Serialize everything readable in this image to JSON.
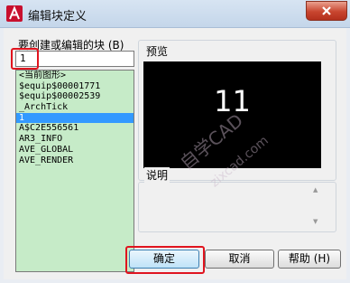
{
  "window": {
    "title": "编辑块定义"
  },
  "name_field": {
    "label": "要创建或编辑的块 (B)",
    "value": "1"
  },
  "block_list": {
    "items": [
      "<当前图形>",
      "$equip$00001771",
      "$equip$00002539",
      "_ArchTick",
      "1",
      "A$C2E556561",
      "AR3_INFO",
      "AVE_GLOBAL",
      "AVE_RENDER"
    ],
    "selected_index": 4
  },
  "preview": {
    "label": "预览",
    "text": "11"
  },
  "description": {
    "label": "说明"
  },
  "buttons": {
    "ok": "确定",
    "cancel": "取消",
    "help": "帮助 (H)"
  },
  "watermark": {
    "line1": "自学CAD",
    "line2": "zixcad.com"
  },
  "colors": {
    "highlight": "#e0141e",
    "list_bg": "#c6ebc8",
    "selection": "#3399ff",
    "preview_bg": "#000000"
  },
  "icons": {
    "app": "autocad-icon",
    "close": "close-icon"
  }
}
